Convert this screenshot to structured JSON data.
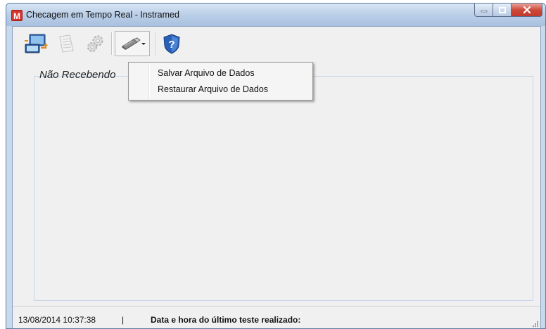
{
  "window": {
    "title": "Checagem em Tempo Real - Instramed",
    "app_icon_letter": "M"
  },
  "toolbar": {
    "buttons": [
      {
        "name": "connect",
        "icon": "computer-transfer-icon"
      },
      {
        "name": "report",
        "icon": "document-icon"
      },
      {
        "name": "settings",
        "icon": "gear-icon"
      },
      {
        "name": "usb-menu",
        "icon": "usb-drive-icon",
        "has_dropdown": true
      },
      {
        "name": "help",
        "icon": "help-shield-icon"
      }
    ]
  },
  "main": {
    "status_label": "Não Recebendo"
  },
  "menu": {
    "items": [
      "Salvar Arquivo de Dados",
      "Restaurar Arquivo de Dados"
    ]
  },
  "statusbar": {
    "datetime": "13/08/2014 10:37:38",
    "separator": "|",
    "label": "Data e hora do último teste realizado:"
  },
  "colors": {
    "frame": "#c9d9ec",
    "client_bg": "#f0f0f0",
    "close_button": "#c2392b",
    "app_icon": "#d8322a"
  }
}
